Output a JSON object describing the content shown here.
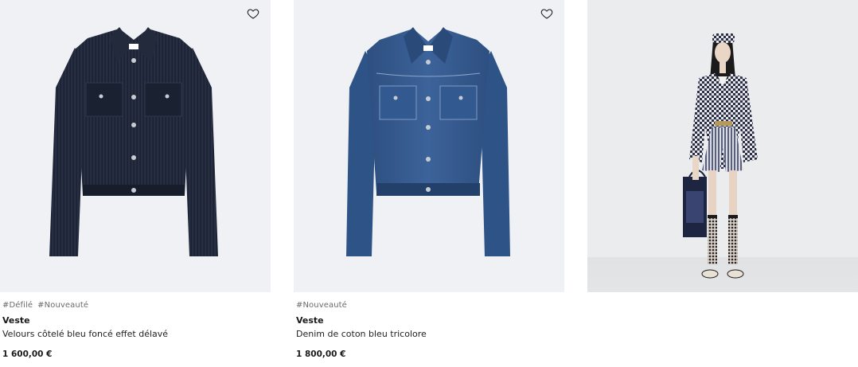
{
  "products": [
    {
      "tags": [
        "#Défilé",
        "#Nouveauté"
      ],
      "title": "Veste",
      "subtitle": "Velours côtelé bleu foncé effet délavé",
      "price": "1 600,00 €",
      "favorite_icon": "heart-outline-icon",
      "image": "dark-navy-corduroy-jacket"
    },
    {
      "tags": [
        "#Nouveauté"
      ],
      "title": "Veste",
      "subtitle": "Denim de coton bleu tricolore",
      "price": "1 800,00 €",
      "favorite_icon": "heart-outline-icon",
      "image": "blue-denim-jacket"
    },
    {
      "image": "model-in-checked-blazer"
    }
  ],
  "colors": {
    "image_background": "#eff1f4",
    "text": "#1a1a1a",
    "tag_text": "#6b6b6b"
  }
}
